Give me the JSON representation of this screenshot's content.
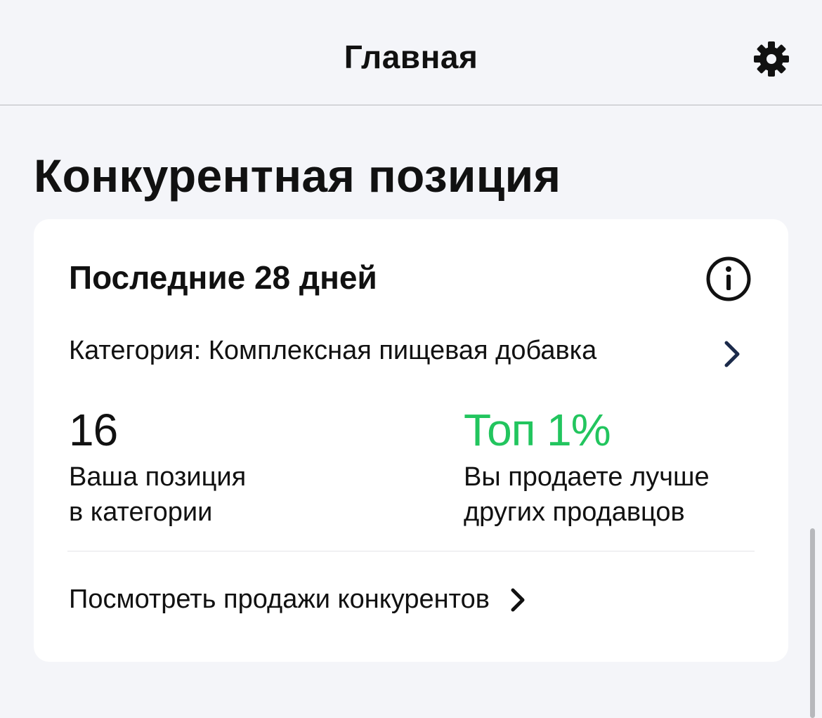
{
  "header": {
    "title": "Главная",
    "settings_icon": "gear-icon"
  },
  "section": {
    "title": "Конкурентная позиция"
  },
  "card": {
    "period": "Последние 28 дней",
    "info_icon": "info-icon",
    "category_label": "Категория: Комплексная пищевая добавка",
    "category_icon": "chevron-right-icon",
    "position": {
      "value": "16",
      "caption_line1": "Ваша позиция",
      "caption_line2": "в категории"
    },
    "top": {
      "value": "Топ 1%",
      "caption_line1": "Вы продаете лучше",
      "caption_line2": "других продавцов"
    },
    "competitors_link": "Посмотреть продажи конкурентов",
    "competitors_icon": "chevron-right-icon"
  },
  "colors": {
    "background": "#f4f5f9",
    "card": "#ffffff",
    "text": "#111111",
    "accent_green": "#22c55e",
    "chevron_navy": "#1b2a4a"
  }
}
